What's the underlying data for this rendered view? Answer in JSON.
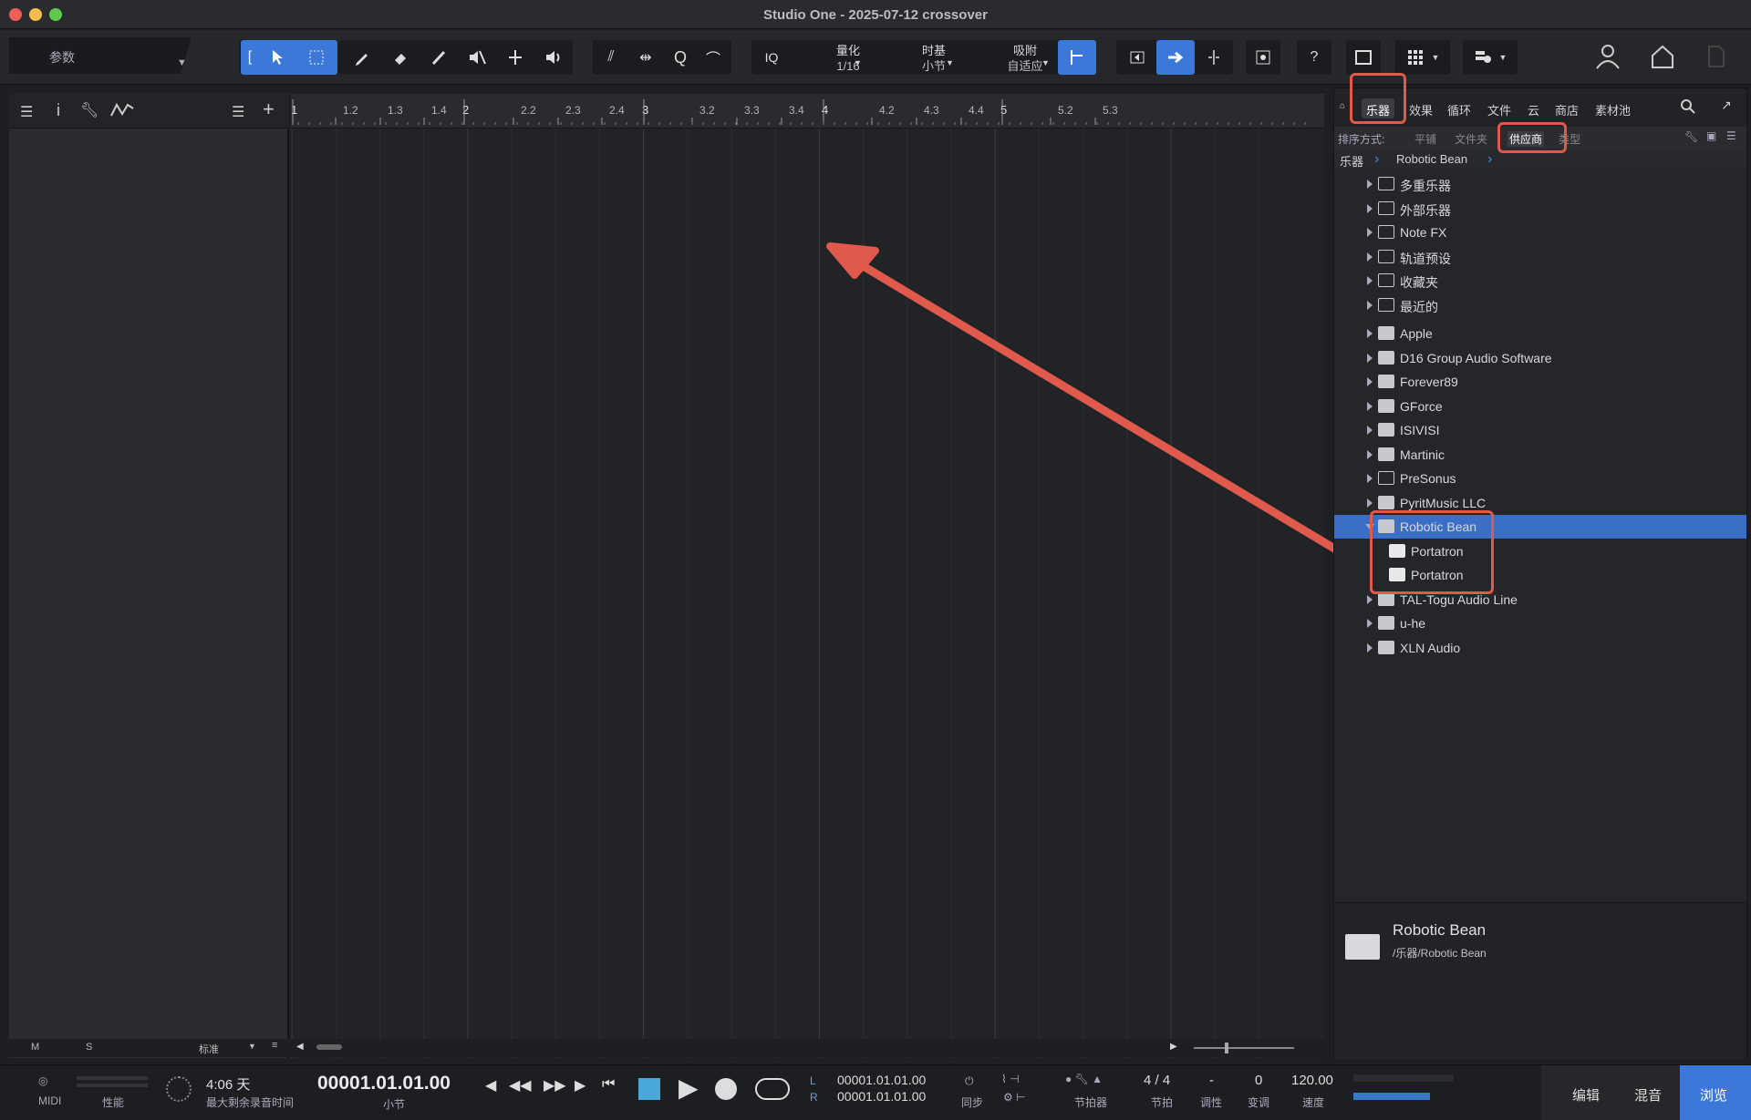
{
  "window": {
    "title": "Studio One - 2025-07-12 crossover"
  },
  "toolbar": {
    "param_label": "参数",
    "quantize": {
      "label": "量化",
      "value": "1/16"
    },
    "timebase": {
      "label": "时基",
      "value": "小节"
    },
    "snap": {
      "label": "吸附",
      "value": "自适应"
    },
    "iq": "IQ",
    "help": "?"
  },
  "ruler": {
    "ticks": [
      "1",
      "1.2",
      "1.3",
      "1.4",
      "2",
      "2.2",
      "2.3",
      "2.4",
      "3",
      "3.2",
      "3.3",
      "3.4",
      "4",
      "4.2",
      "4.3",
      "4.4",
      "5",
      "5.2",
      "5.3"
    ]
  },
  "track_footer": {
    "m": "M",
    "s": "S",
    "mode": "标准"
  },
  "browser": {
    "tabs": [
      "乐器",
      "效果",
      "循环",
      "文件",
      "云",
      "商店",
      "素材池"
    ],
    "sort_label": "排序方式:",
    "sort_options": [
      "平铺",
      "文件夹",
      "供应商",
      "类型"
    ],
    "breadcrumb": [
      "乐器",
      "Robotic Bean"
    ],
    "items": [
      {
        "label": "多重乐器",
        "icon": "multi-instrument-icon"
      },
      {
        "label": "外部乐器",
        "icon": "external-instrument-icon"
      },
      {
        "label": "Note FX",
        "icon": "notefx-icon"
      },
      {
        "label": "轨道预设",
        "icon": "track-preset-icon"
      },
      {
        "label": "收藏夹",
        "icon": "star-icon"
      },
      {
        "label": "最近的",
        "icon": "clock-icon"
      },
      {
        "label": "Apple",
        "icon": "folder-icon"
      },
      {
        "label": "D16 Group Audio Software",
        "icon": "folder-icon"
      },
      {
        "label": "Forever89",
        "icon": "folder-icon"
      },
      {
        "label": "GForce",
        "icon": "folder-icon"
      },
      {
        "label": "ISIVISI",
        "icon": "folder-icon"
      },
      {
        "label": "Martinic",
        "icon": "folder-icon"
      },
      {
        "label": "PreSonus",
        "icon": "presonus-icon"
      },
      {
        "label": "PyritMusic LLC",
        "icon": "folder-icon"
      },
      {
        "label": "Robotic Bean",
        "icon": "folder-open-icon",
        "selected": true
      },
      {
        "label": "Portatron",
        "icon": "plugin-icon",
        "child": true
      },
      {
        "label": "Portatron",
        "icon": "plugin-icon",
        "child": true
      },
      {
        "label": "TAL-Togu Audio Line",
        "icon": "folder-icon"
      },
      {
        "label": "u-he",
        "icon": "folder-icon"
      },
      {
        "label": "XLN Audio",
        "icon": "folder-icon"
      }
    ],
    "info": {
      "name": "Robotic Bean",
      "path": "/乐器/Robotic Bean"
    }
  },
  "transport": {
    "midi": "MIDI",
    "perf": "性能",
    "remain": "4:06 天",
    "remain_label": "最大剩余录音时间",
    "position": "00001.01.01.00",
    "position_unit": "小节",
    "loop_l": "00001.01.01.00",
    "loop_r": "00001.01.01.00",
    "l": "L",
    "r": "R",
    "sync": "同步",
    "metronome": "节拍器",
    "timesig": "4 / 4",
    "timesig_label": "节拍",
    "key": "-",
    "key_label": "调性",
    "transpose": "0",
    "transpose_label": "变调",
    "tempo": "120.00",
    "tempo_label": "速度",
    "edit": "编辑",
    "mix": "混音",
    "browse": "浏览"
  }
}
